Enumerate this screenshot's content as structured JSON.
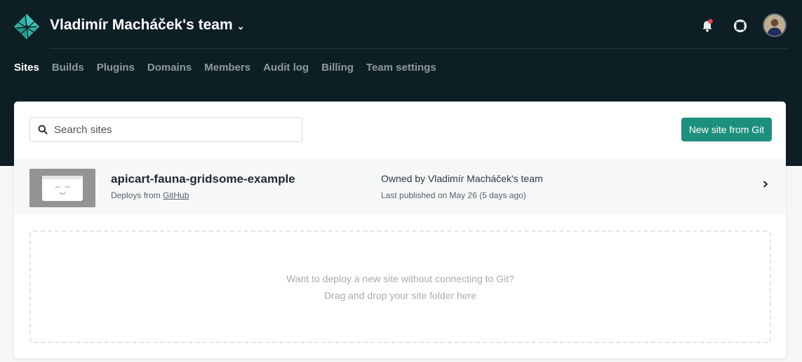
{
  "header": {
    "team_name": "Vladimír Macháček's team",
    "team_chevron": "⌄"
  },
  "nav": {
    "items": [
      {
        "label": "Sites",
        "active": true
      },
      {
        "label": "Builds"
      },
      {
        "label": "Plugins"
      },
      {
        "label": "Domains"
      },
      {
        "label": "Members"
      },
      {
        "label": "Audit log"
      },
      {
        "label": "Billing"
      },
      {
        "label": "Team settings"
      }
    ]
  },
  "search": {
    "placeholder": "Search sites",
    "value": ""
  },
  "new_site_button": "New site from Git",
  "sites": [
    {
      "name": "apicart-fauna-gridsome-example",
      "deploys_prefix": "Deploys from",
      "deploys_source": "GitHub",
      "owner": "Owned by Vladimír Macháček's team",
      "published": "Last published on May 26 (5 days ago)"
    }
  ],
  "dropzone": {
    "line1": "Want to deploy a new site without connecting to Git?",
    "line2": "Drag and drop your site folder here"
  },
  "colors": {
    "header_bg": "#0e1e25",
    "accent": "#1c8f7d",
    "notification_dot": "#e8434f"
  },
  "icons": {
    "logo": "netlify-logo-icon",
    "bell": "bell-icon",
    "help": "lifebuoy-icon",
    "search": "search-icon",
    "row_chevron": "chevron-right-icon"
  }
}
